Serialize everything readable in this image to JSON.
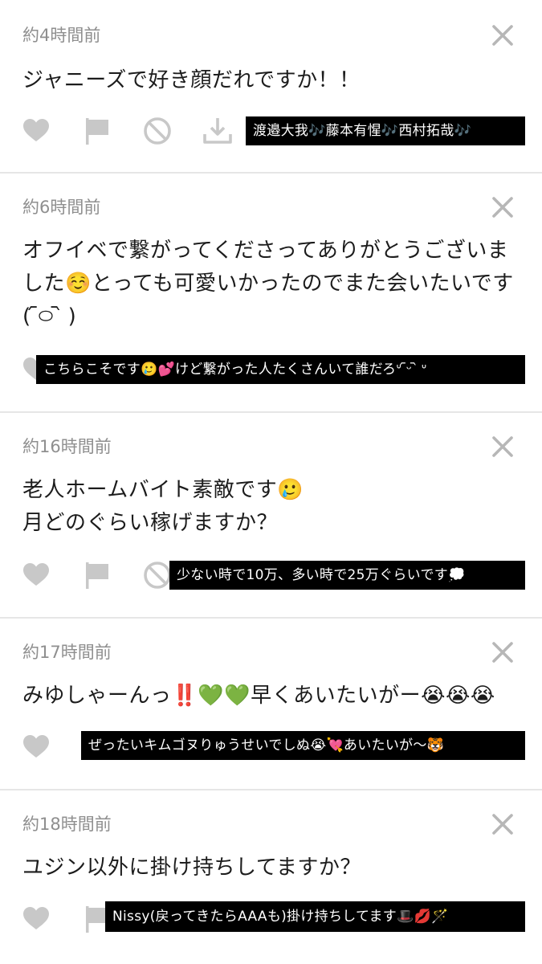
{
  "colors": {
    "icon_gray": "#c8c8c8",
    "close_gray": "#b7b7b7",
    "timestamp_gray": "#8f8f8f",
    "overlay_bg": "#000000",
    "overlay_text": "#ffffff"
  },
  "icons": [
    "heart-icon",
    "flag-icon",
    "block-icon",
    "download-icon",
    "close-icon"
  ],
  "cards": [
    {
      "timestamp": "約4時間前",
      "question": "ジャニーズで好き顔だれですか！！",
      "reply": "渡邉大我🎶藤本有惺🎶西村拓哉🎶"
    },
    {
      "timestamp": "約6時間前",
      "question": "オフイベで繋がってくださってありがとうございました☺️とっても可愛いかったのでまた会いたいです( ᷇࿀ ᷆ )",
      "reply": "こちらこそです🥲💕けど繋がった人たくさんいて誰だろᐡ ᷇ᵕ ᷆ ᐡ"
    },
    {
      "timestamp": "約16時間前",
      "question": "老人ホームバイト素敵です🥲\n月どのぐらい稼げますか？",
      "reply": "少ない時で10万、多い時で25万ぐらいです💭"
    },
    {
      "timestamp": "約17時間前",
      "question": "みゆしゃーんっ‼️💚💚早くあいたいがー😭😭😭",
      "reply": "ぜったいキムゴヌりゅうせいでしぬ😭💘あいたいが〜🐯"
    },
    {
      "timestamp": "約18時間前",
      "question": "ユジン以外に掛け持ちしてますか？",
      "reply": "Nissy(戻ってきたらAAAも)掛け持ちしてます🎩💋🪄"
    }
  ]
}
